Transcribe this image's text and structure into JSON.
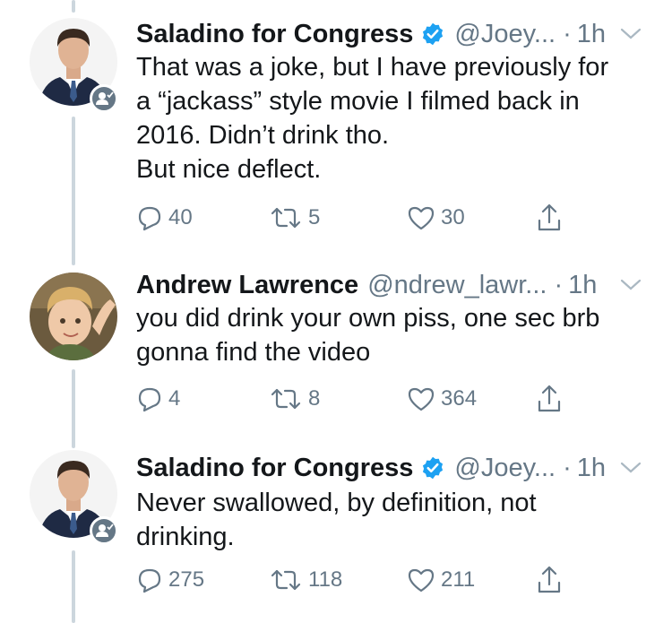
{
  "colors": {
    "verified": "#1da1f2",
    "meta": "#657786",
    "thread_line": "#ccd6dd"
  },
  "tweets": [
    {
      "name": "Saladino for Congress",
      "handle": "@Joey...",
      "dot": "·",
      "time": "1h",
      "verified": true,
      "avatar": "person-in-suit-avatar",
      "lines": [
        "That was a joke, but I have previously for",
        "a “jackass” style movie I filmed back in",
        "2016. Didn’t drink tho.",
        "But nice deflect."
      ],
      "replies": "40",
      "retweets": "5",
      "likes": "30"
    },
    {
      "name": "Andrew Lawrence",
      "handle": "@ndrew_lawr...",
      "dot": "·",
      "time": "1h",
      "verified": false,
      "avatar": "child-photo-avatar",
      "lines": [
        "you did drink your own piss, one sec brb",
        "gonna find the video"
      ],
      "replies": "4",
      "retweets": "8",
      "likes": "364"
    },
    {
      "name": "Saladino for Congress",
      "handle": "@Joey...",
      "dot": "·",
      "time": "1h",
      "verified": true,
      "avatar": "person-in-suit-avatar",
      "lines": [
        "Never swallowed, by definition, not",
        "drinking."
      ],
      "replies": "275",
      "retweets": "118",
      "likes": "211"
    }
  ]
}
